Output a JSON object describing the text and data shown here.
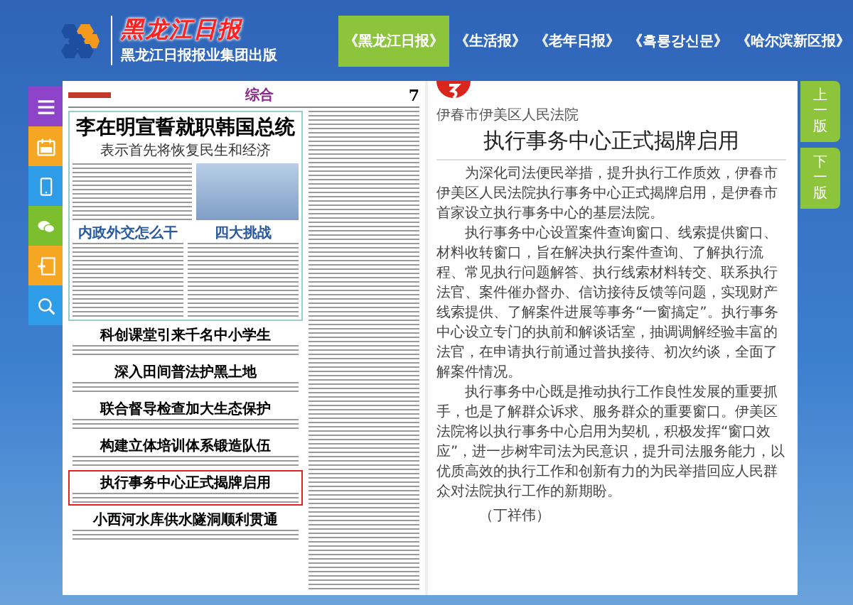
{
  "header": {
    "logo_text": "黑龙江日报",
    "publisher": "黑龙江日报报业集团出版"
  },
  "tabs": [
    {
      "label": "《黑龙江日报》",
      "selected": true
    },
    {
      "label": "《生活报》",
      "selected": false
    },
    {
      "label": "《老年日报》",
      "selected": false
    },
    {
      "label": "《흑룡강신문》",
      "selected": false
    },
    {
      "label": "《哈尔滨新区报》",
      "selected": false
    }
  ],
  "toolbar": [
    {
      "kind": "menu",
      "color": "#8e44c8"
    },
    {
      "kind": "calendar",
      "color": "#f5a623"
    },
    {
      "kind": "mobile",
      "color": "#2f9ce8"
    },
    {
      "kind": "chat",
      "color": "#7cbf2e"
    },
    {
      "kind": "directory",
      "color": "#f5a623"
    },
    {
      "kind": "search",
      "color": "#2f9ce8"
    }
  ],
  "newspaper": {
    "section": "综合",
    "page_number": "7",
    "lead_headline": "李在明宣誓就职韩国总统",
    "lead_subtitle": "表示首先将恢复民生和经济",
    "sub_headlines": [
      "内政外交怎么干",
      "四大挑战"
    ],
    "stories": [
      {
        "headline": "科创课堂引来千名中小学生",
        "highlighted": false
      },
      {
        "headline": "深入田间普法护黑土地",
        "highlighted": false
      },
      {
        "headline": "联合督导检查加大生态保护",
        "highlighted": false
      },
      {
        "headline": "构建立体培训体系锻造队伍",
        "highlighted": false
      },
      {
        "headline": "执行事务中心正式揭牌启用",
        "highlighted": true
      },
      {
        "headline": "小西河水库供水隧洞顺利贯通",
        "highlighted": false
      }
    ]
  },
  "article": {
    "source": "伊春市伊美区人民法院",
    "title": "执行事务中心正式揭牌启用",
    "paragraphs": [
      "为深化司法便民举措，提升执行工作质效，伊春市伊美区人民法院执行事务中心正式揭牌启用，是伊春市首家设立执行事务中心的基层法院。",
      "执行事务中心设置案件查询窗口、线索提供窗口、材料收转窗口，旨在解决执行案件查询、了解执行流程、常见执行问题解答、执行线索材料转交、联系执行法官、案件催办督办、信访接待反馈等问题，实现财产线索提供、了解案件进展等事务“一窗搞定”。执行事务中心设立专门的执前和解谈话室，抽调调解经验丰富的法官，在申请执行前通过普执接待、初次约谈，全面了解案件情况。",
      "执行事务中心既是推动执行工作良性发展的重要抓手，也是了解群众诉求、服务群众的重要窗口。伊美区法院将以执行事务中心启用为契机，积极发挥“窗口效应”，进一步树牢司法为民意识，提升司法服务能力，以优质高效的执行工作和创新有力的为民举措回应人民群众对法院执行工作的新期盼。"
    ],
    "byline": "（丁祥伟）"
  },
  "page_nav": [
    {
      "label": "上一版"
    },
    {
      "label": "下一版"
    }
  ]
}
